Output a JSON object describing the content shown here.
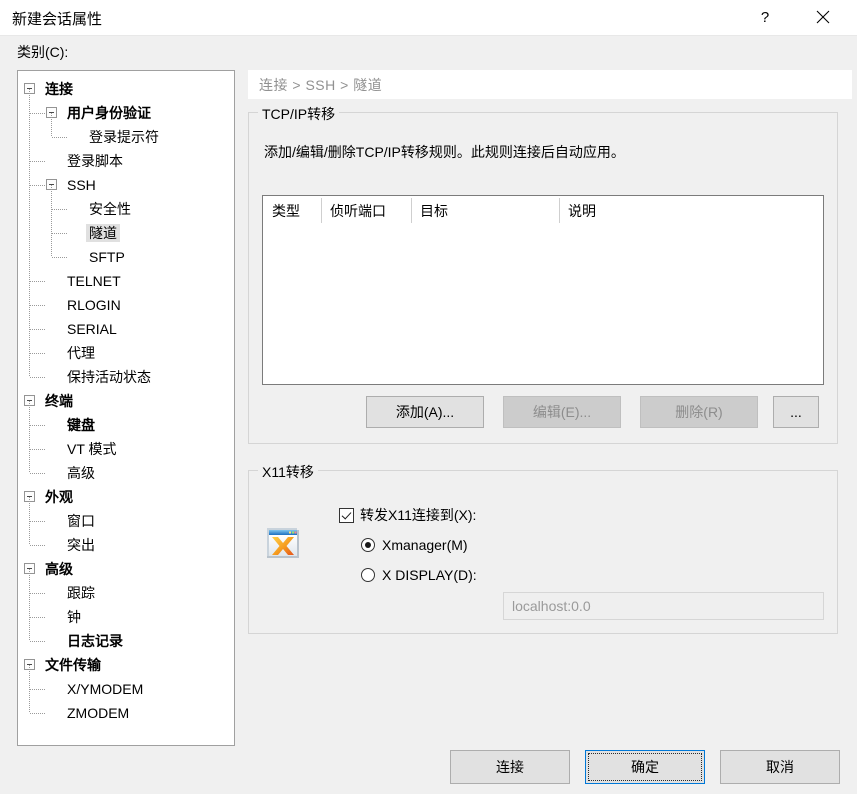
{
  "window": {
    "title": "新建会话属性",
    "help_icon": "?",
    "close_icon": "✕"
  },
  "category": {
    "label": "类别(C):",
    "tree": [
      {
        "label": "连接",
        "level": 0,
        "bold": true,
        "expander": true,
        "selected": false
      },
      {
        "label": "用户身份验证",
        "level": 1,
        "bold": true,
        "expander": true,
        "selected": false
      },
      {
        "label": "登录提示符",
        "level": 2,
        "bold": false,
        "expander": false,
        "selected": false
      },
      {
        "label": "登录脚本",
        "level": 1,
        "bold": false,
        "expander": false,
        "selected": false
      },
      {
        "label": "SSH",
        "level": 1,
        "bold": false,
        "expander": true,
        "selected": false
      },
      {
        "label": "安全性",
        "level": 2,
        "bold": false,
        "expander": false,
        "selected": false
      },
      {
        "label": "隧道",
        "level": 2,
        "bold": false,
        "expander": false,
        "selected": true
      },
      {
        "label": "SFTP",
        "level": 2,
        "bold": false,
        "expander": false,
        "selected": false
      },
      {
        "label": "TELNET",
        "level": 1,
        "bold": false,
        "expander": false,
        "selected": false
      },
      {
        "label": "RLOGIN",
        "level": 1,
        "bold": false,
        "expander": false,
        "selected": false
      },
      {
        "label": "SERIAL",
        "level": 1,
        "bold": false,
        "expander": false,
        "selected": false
      },
      {
        "label": "代理",
        "level": 1,
        "bold": false,
        "expander": false,
        "selected": false
      },
      {
        "label": "保持活动状态",
        "level": 1,
        "bold": false,
        "expander": false,
        "selected": false
      },
      {
        "label": "终端",
        "level": 0,
        "bold": true,
        "expander": true,
        "selected": false
      },
      {
        "label": "键盘",
        "level": 1,
        "bold": true,
        "expander": false,
        "selected": false
      },
      {
        "label": "VT 模式",
        "level": 1,
        "bold": false,
        "expander": false,
        "selected": false
      },
      {
        "label": "高级",
        "level": 1,
        "bold": false,
        "expander": false,
        "selected": false
      },
      {
        "label": "外观",
        "level": 0,
        "bold": true,
        "expander": true,
        "selected": false
      },
      {
        "label": "窗口",
        "level": 1,
        "bold": false,
        "expander": false,
        "selected": false
      },
      {
        "label": "突出",
        "level": 1,
        "bold": false,
        "expander": false,
        "selected": false
      },
      {
        "label": "高级",
        "level": 0,
        "bold": true,
        "expander": true,
        "selected": false
      },
      {
        "label": "跟踪",
        "level": 1,
        "bold": false,
        "expander": false,
        "selected": false
      },
      {
        "label": "钟",
        "level": 1,
        "bold": false,
        "expander": false,
        "selected": false
      },
      {
        "label": "日志记录",
        "level": 1,
        "bold": true,
        "expander": false,
        "selected": false
      },
      {
        "label": "文件传输",
        "level": 0,
        "bold": true,
        "expander": true,
        "selected": false
      },
      {
        "label": "X/YMODEM",
        "level": 1,
        "bold": false,
        "expander": false,
        "selected": false
      },
      {
        "label": "ZMODEM",
        "level": 1,
        "bold": false,
        "expander": false,
        "selected": false
      }
    ]
  },
  "breadcrumb": {
    "text": "连接 > SSH > 隧道"
  },
  "tcpip_group": {
    "legend": "TCP/IP转移",
    "description": "添加/编辑/删除TCP/IP转移规则。此规则连接后自动应用。",
    "table": {
      "columns": [
        "类型",
        "侦听端口",
        "目标",
        "说明"
      ],
      "rows": []
    },
    "buttons": {
      "add": "添加(A)...",
      "edit": "编辑(E)...",
      "delete": "删除(R)",
      "more": "..."
    }
  },
  "x11_group": {
    "legend": "X11转移",
    "icon": "xmanager-app-icon",
    "forward_checkbox": {
      "label": "转发X11连接到(X):",
      "checked": true
    },
    "options": [
      {
        "label": "Xmanager(M)",
        "selected": true
      },
      {
        "label": "X DISPLAY(D):",
        "selected": false
      }
    ],
    "display_input": {
      "value": "",
      "placeholder": "localhost:0.0"
    }
  },
  "footer": {
    "connect": "连接",
    "ok": "确定",
    "cancel": "取消"
  },
  "colors": {
    "dialog_bg": "#f0f0f0",
    "accent_focus": "#0078d7",
    "breadcrumb_text": "#919191",
    "selection_bg": "#e0e0e0"
  }
}
